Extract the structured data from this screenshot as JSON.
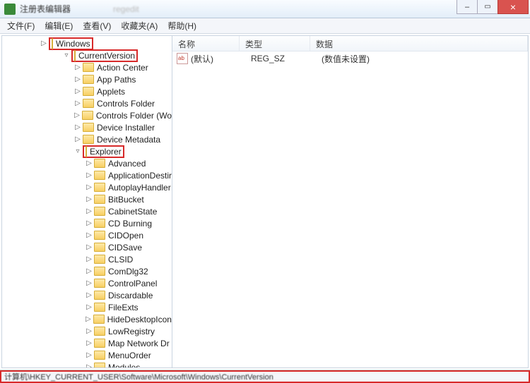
{
  "window": {
    "title": "注册表编辑器"
  },
  "menu": {
    "file": "文件(F)",
    "edit": "编辑(E)",
    "view": "查看(V)",
    "favorites": "收藏夹(A)",
    "help": "帮助(H)"
  },
  "tree": {
    "windows": "Windows",
    "currentversion": "CurrentVersion",
    "items_level3": [
      "Action Center",
      "App Paths",
      "Applets",
      "Controls Folder",
      "Controls Folder (Wo",
      "Device Installer",
      "Device Metadata"
    ],
    "explorer": "Explorer",
    "items_level4": [
      "Advanced",
      "ApplicationDestir",
      "AutoplayHandler",
      "BitBucket",
      "CabinetState",
      "CD Burning",
      "CIDOpen",
      "CIDSave",
      "CLSID",
      "ComDlg32",
      "ControlPanel",
      "Discardable",
      "FileExts",
      "HideDesktopIcon",
      "LowRegistry",
      "Map Network Dr",
      "MenuOrder",
      "Modules"
    ]
  },
  "list": {
    "col_name": "名称",
    "col_type": "类型",
    "col_data": "数据",
    "row_name": "(默认)",
    "row_type": "REG_SZ",
    "row_data": "(数值未设置)"
  },
  "status": {
    "path": "计算机\\HKEY_CURRENT_USER\\Software\\Microsoft\\Windows\\CurrentVersion"
  }
}
